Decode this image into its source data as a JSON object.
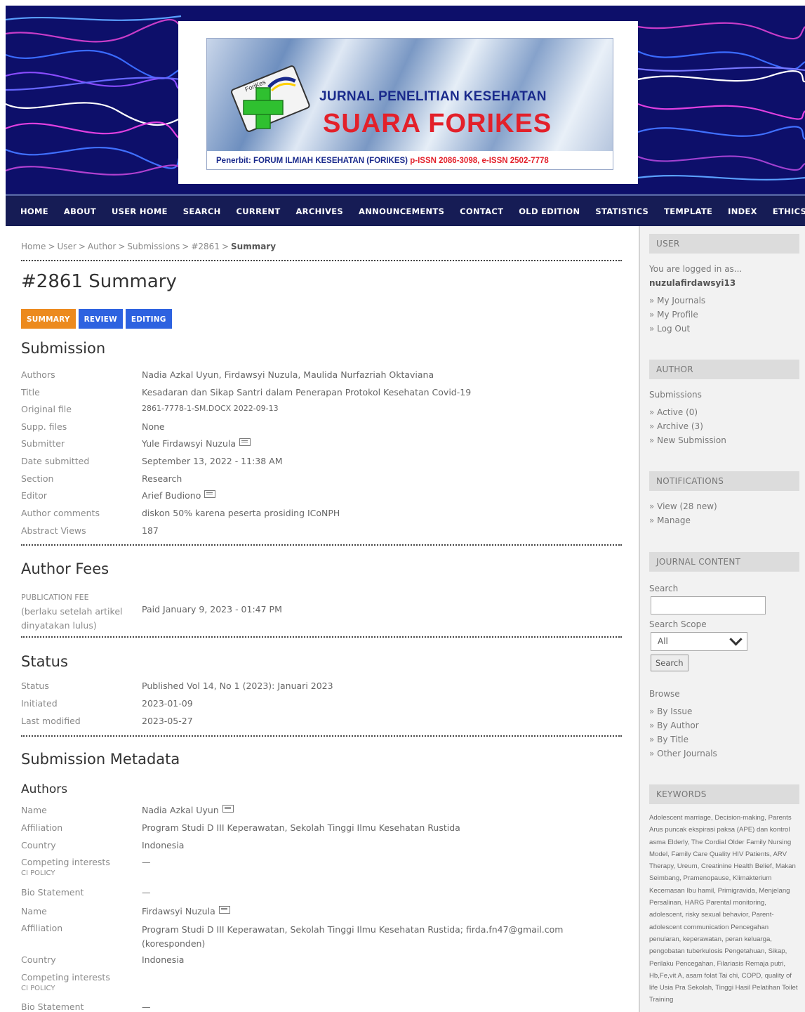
{
  "header": {
    "logo_line1": "JURNAL PENELITIAN KESEHATAN",
    "logo_line2": "SUARA FORIKES",
    "logo_line3_blue": "Penerbit: FORUM ILMIAH KESEHATAN (FORIKES)",
    "logo_line3_red": "p-ISSN 2086-3098, e-ISSN 2502-7778",
    "emblem_text": "ForiKes"
  },
  "nav": {
    "items": [
      "HOME",
      "ABOUT",
      "USER HOME",
      "SEARCH",
      "CURRENT",
      "ARCHIVES",
      "ANNOUNCEMENTS",
      "CONTACT",
      "OLD EDITION",
      "STATISTICS",
      "TEMPLATE",
      "INDEX",
      "ETHICS"
    ]
  },
  "breadcrumb": {
    "items": [
      "Home",
      "User",
      "Author",
      "Submissions",
      "#2861"
    ],
    "sep": ">",
    "current": "Summary"
  },
  "page_title": "#2861 Summary",
  "tabs": [
    "SUMMARY",
    "REVIEW",
    "EDITING"
  ],
  "submission": {
    "heading": "Submission",
    "rows": [
      {
        "label": "Authors",
        "value": "Nadia Azkal Uyun, Firdawsyi Nuzula, Maulida Nurfazriah Oktaviana"
      },
      {
        "label": "Title",
        "value": "Kesadaran dan Sikap Santri dalam Penerapan Protokol Kesehatan Covid-19"
      },
      {
        "label": "Original file",
        "value": "2861-7778-1-SM.DOCX  2022-09-13"
      },
      {
        "label": "Supp. files",
        "value": "None"
      },
      {
        "label": "Submitter",
        "value": "Yule Firdawsyi Nuzula"
      },
      {
        "label": "Date submitted",
        "value": "September 13, 2022 - 11:38 AM"
      },
      {
        "label": "Section",
        "value": "Research"
      },
      {
        "label": "Editor",
        "value": "Arief Budiono"
      },
      {
        "label": "Author comments",
        "value": "diskon 50% karena peserta prosiding ICoNPH"
      },
      {
        "label": "Abstract Views",
        "value": "187"
      }
    ]
  },
  "fees": {
    "heading": "Author Fees",
    "label_top": "PUBLICATION FEE",
    "label_bottom": "(berlaku setelah artikel dinyatakan lulus)",
    "value": "Paid January 9, 2023 - 01:47 PM"
  },
  "status": {
    "heading": "Status",
    "rows": [
      {
        "label": "Status",
        "value": "Published   Vol 14, No 1 (2023): Januari 2023"
      },
      {
        "label": "Initiated",
        "value": "2023-01-09"
      },
      {
        "label": "Last modified",
        "value": "2023-05-27"
      }
    ]
  },
  "metadata": {
    "heading": "Submission Metadata",
    "authors_heading": "Authors",
    "ci_policy": "CI POLICY",
    "author1": {
      "name_label": "Name",
      "name": "Nadia Azkal Uyun",
      "affiliation_label": "Affiliation",
      "affiliation": "Program Studi D III Keperawatan, Sekolah Tinggi Ilmu Kesehatan Rustida",
      "country_label": "Country",
      "country": "Indonesia",
      "competing_label": "Competing interests",
      "competing": "—",
      "bio_label": "Bio Statement",
      "bio": "—"
    },
    "author2": {
      "name_label": "Name",
      "name": "Firdawsyi Nuzula",
      "affiliation_label": "Affiliation",
      "affiliation": "Program Studi D III Keperawatan, Sekolah Tinggi Ilmu Kesehatan Rustida; firda.fn47@gmail.com (koresponden)",
      "country_label": "Country",
      "country": "Indonesia",
      "competing_label": "Competing interests",
      "competing": "",
      "bio_label": "Bio Statement",
      "bio": "—"
    }
  },
  "sidebar": {
    "user": {
      "heading": "USER",
      "logged_in": "You are logged in as...",
      "username": "nuzulafirdawsyi13",
      "links": [
        "My Journals",
        "My Profile",
        "Log Out"
      ]
    },
    "author": {
      "heading": "AUTHOR",
      "submissions": "Submissions",
      "links": [
        "Active (0)",
        "Archive (3)",
        "New Submission"
      ]
    },
    "notifications": {
      "heading": "NOTIFICATIONS",
      "links": [
        "View (28 new)",
        "Manage"
      ]
    },
    "journal_content": {
      "heading": "JOURNAL CONTENT",
      "search_label": "Search",
      "scope_label": "Search Scope",
      "scope_value": "All",
      "search_button": "Search",
      "browse_label": "Browse",
      "links": [
        "By Issue",
        "By Author",
        "By Title",
        "Other Journals"
      ]
    },
    "keywords": {
      "heading": "KEYWORDS",
      "text": "Adolescent marriage, Decision-making, Parents Arus puncak ekspirasi paksa (APE) dan kontrol asma Elderly, The Cordial Older Family Nursing Model, Family Care Quality HIV Patients, ARV Therapy, Ureum, Creatinine Health Belief, Makan Seimbang, Pramenopause, Klimakterium Kecemasan Ibu hamil, Primigravida, Menjelang Persalinan, HARG Parental monitoring, adolescent, risky sexual behavior, Parent-adolescent communication Pencegahan penularan, keperawatan, peran keluarga, pengobatan tuberkulosis Pengetahuan, Sikap, Perilaku Pencegahan, Filariasis Remaja putri, Hb,Fe,vit A, asam folat Tai chi, COPD, quality of life Usia Pra Sekolah, Tinggi Hasil Pelatihan Toilet Training"
    }
  },
  "colors": {
    "nav_bg": "#161c55",
    "header_bg": "#0d0f6a",
    "tab_summary": "#ec8a1e",
    "tab_other": "#2d62e0"
  }
}
